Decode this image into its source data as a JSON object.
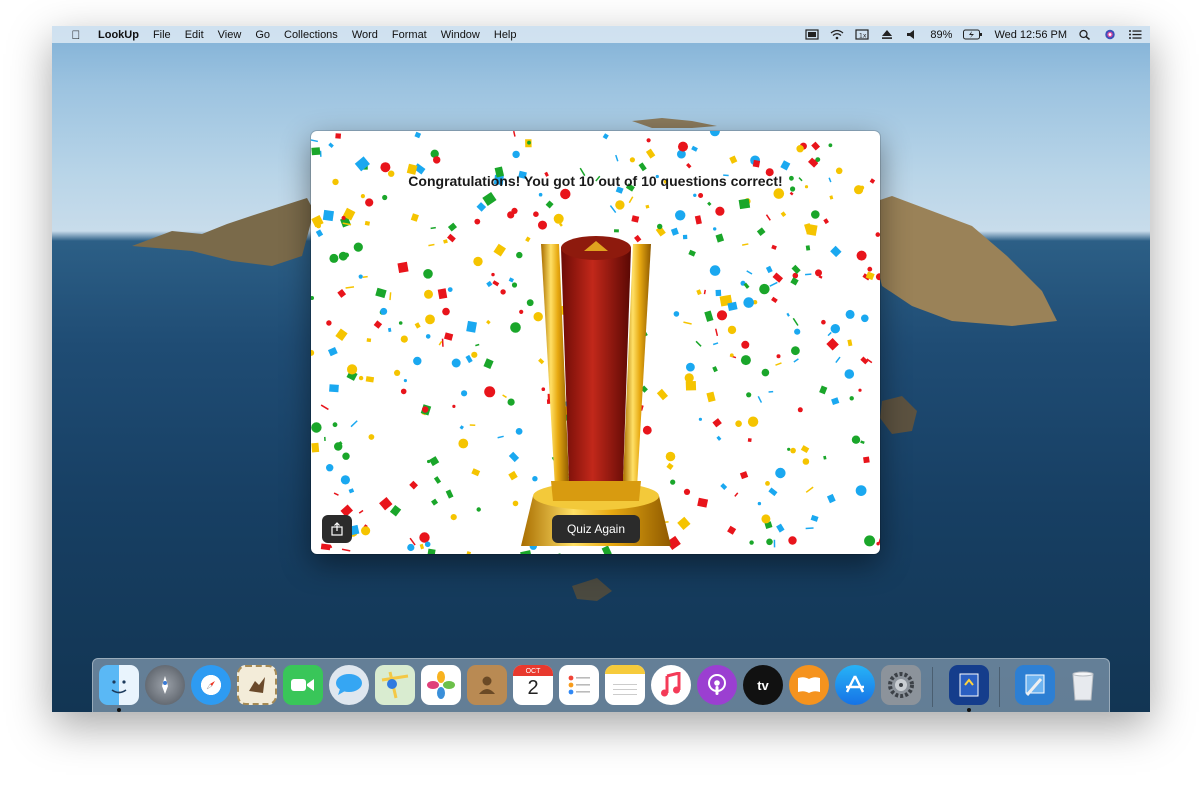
{
  "menubar": {
    "app_name": "LookUp",
    "menus": [
      "File",
      "Edit",
      "View",
      "Go",
      "Collections",
      "Word",
      "Format",
      "Window",
      "Help"
    ],
    "battery": "89%",
    "clock": "Wed 12:56 PM"
  },
  "window": {
    "result_text": "Congratulations! You got 10 out of 10 questions correct!",
    "quiz_again_label": "Quiz Again",
    "confetti_colors": [
      "#e8141b",
      "#1aa62a",
      "#f5c400",
      "#1aa8f0"
    ]
  },
  "dock": {
    "calendar_month": "OCT",
    "calendar_day": "2",
    "tv_label": "tv",
    "apps": [
      "finder",
      "launchpad",
      "safari",
      "mail",
      "facetime",
      "messages",
      "maps",
      "photos",
      "contacts",
      "calendar",
      "reminders",
      "notes",
      "music",
      "podcasts",
      "tv",
      "books",
      "app-store",
      "system-preferences",
      "lookup",
      "xcode",
      "trash"
    ]
  }
}
